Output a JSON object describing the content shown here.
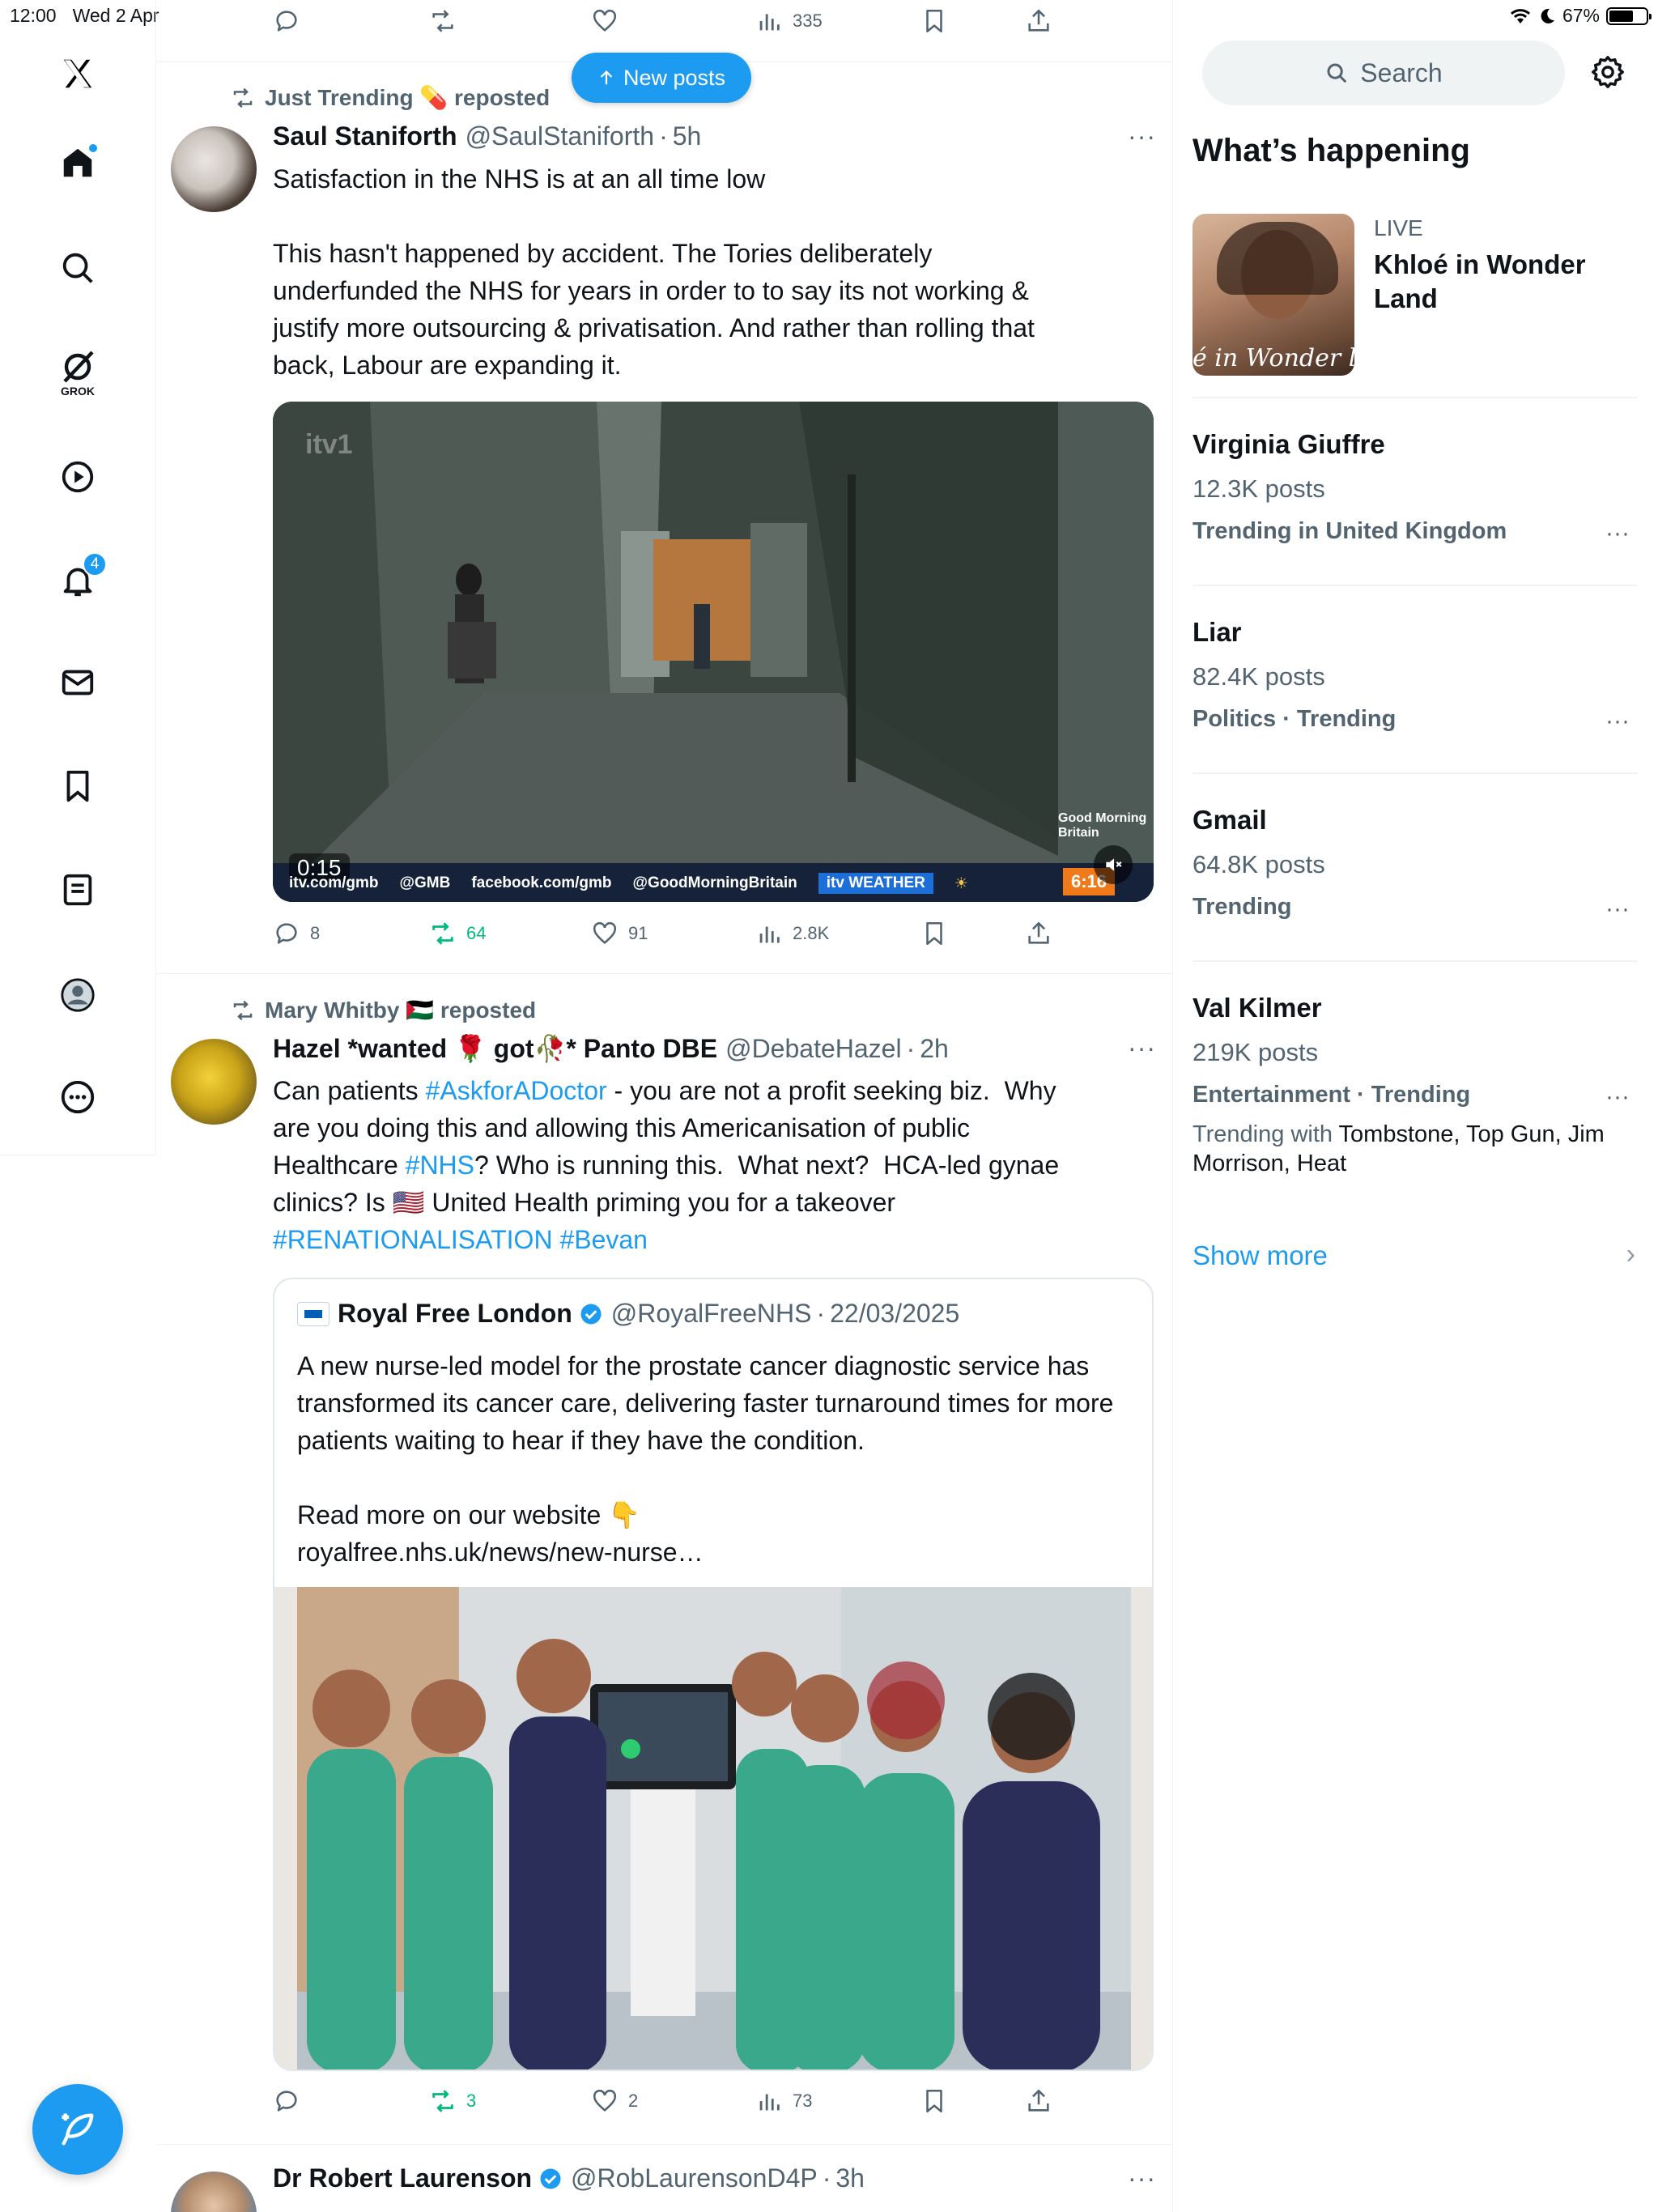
{
  "status_bar": {
    "time": "12:00",
    "date": "Wed 2 Apr",
    "battery": "67%"
  },
  "nav": {
    "grok_label": "GROK",
    "notifications_badge": "4"
  },
  "new_posts_label": "New posts",
  "top_actions": {
    "views": "335"
  },
  "posts": [
    {
      "repost_by": "Just Trending 💊 reposted",
      "name": "Saul Staniforth",
      "handle": "@SaulStaniforth",
      "time": "5h",
      "text": "Satisfaction in the NHS is at an all time low\n\nThis hasn't happened by accident. The Tories deliberately underfunded the NHS for years in order to to say its not working & justify more outsourcing & privatisation. And rather than rolling that back, Labour are expanding it.",
      "video": {
        "watermark": "itv1",
        "duration": "0:15",
        "ticker": "itv.com/gmb",
        "ticker_x": "@GMB",
        "ticker_fb": "facebook.com/gmb",
        "ticker_tt": "@GoodMorningBritain",
        "weather": "itv WEATHER",
        "clock": "6:16",
        "show_logo": "Good Morning Britain"
      },
      "stats": {
        "replies": "8",
        "reposts": "64",
        "likes": "91",
        "views": "2.8K"
      }
    },
    {
      "repost_by": "Mary Whitby 🇵🇸 reposted",
      "name": "Hazel *wanted 🌹 got🥀* Panto DBE",
      "handle": "@DebateHazel",
      "time": "2h",
      "text_parts": {
        "p1": "Can patients ",
        "tag1": "#AskforADoctor",
        "p2": " - you are not a profit seeking biz.  Why are you doing this and allowing this Americanisation of public Healthcare ",
        "tag2": "#NHS",
        "p3": "? Who is running this.  What next?  HCA-led gynae clinics? Is 🇺🇸 United Health priming you for a takeover ",
        "tag3": "#RENATIONALISATION",
        "p4": " ",
        "tag4": "#Bevan"
      },
      "quote": {
        "name": "Royal Free London",
        "handle": "@RoyalFreeNHS",
        "date": "22/03/2025",
        "text": "A new nurse-led model for the prostate cancer diagnostic service has transformed its cancer care, delivering faster turnaround times for more patients waiting to hear if they have the condition.\n\nRead more on our website 👇\nroyalfree.nhs.uk/news/new-nurse…"
      },
      "stats": {
        "replies": "",
        "reposts": "3",
        "likes": "2",
        "views": "73"
      }
    },
    {
      "name": "Dr Robert Laurenson",
      "handle": "@RobLaurensonD4P",
      "time": "3h"
    }
  ],
  "sidebar": {
    "search_placeholder": "Search",
    "whats_happening": "What’s happening",
    "featured": {
      "live": "LIVE",
      "title": "Khloé in Wonder Land",
      "image_text": "é in Wonder l"
    },
    "trends": [
      {
        "name": "Virginia Giuffre",
        "count": "12.3K posts",
        "meta": "Trending in United Kingdom"
      },
      {
        "name": "Liar",
        "count": "82.4K posts",
        "meta": "Politics · Trending"
      },
      {
        "name": "Gmail",
        "count": "64.8K posts",
        "meta": "Trending"
      },
      {
        "name": "Val Kilmer",
        "count": "219K posts",
        "meta": "Entertainment · Trending",
        "with_prefix": "Trending with ",
        "with": "Tombstone, Top Gun, Jim Morrison, Heat"
      }
    ],
    "show_more": "Show more"
  },
  "colors": {
    "accent": "#1d9bf0",
    "repost_green": "#00ba7c",
    "secondary_text": "#536471"
  }
}
